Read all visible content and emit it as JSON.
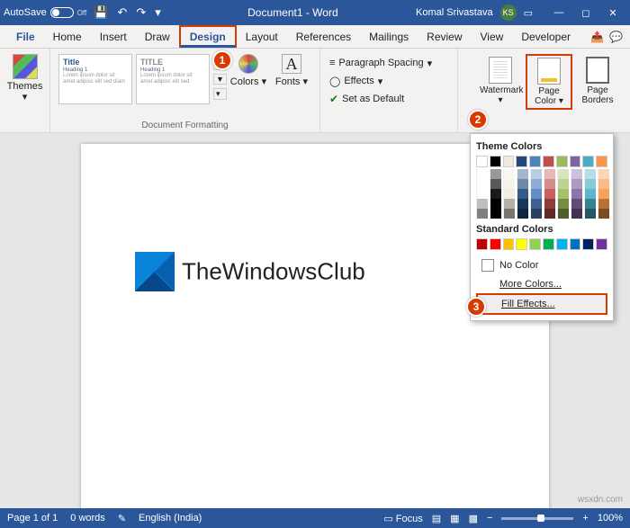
{
  "titlebar": {
    "autosave_label": "AutoSave",
    "autosave_state": "Off",
    "doc_title": "Document1 - Word",
    "user_name": "Komal Srivastava",
    "user_initials": "KS"
  },
  "tabs": {
    "file": "File",
    "home": "Home",
    "insert": "Insert",
    "draw": "Draw",
    "design": "Design",
    "layout": "Layout",
    "references": "References",
    "mailings": "Mailings",
    "review": "Review",
    "view": "View",
    "developer": "Developer"
  },
  "ribbon": {
    "themes": "Themes",
    "colors": "Colors",
    "fonts": "Fonts",
    "paragraph_spacing": "Paragraph Spacing",
    "effects": "Effects",
    "set_default": "Set as Default",
    "doc_formatting": "Document Formatting",
    "watermark": "Watermark",
    "page_color": "Page Color",
    "page_borders": "Page Borders",
    "style_title": "Title",
    "style_title2": "TITLE",
    "style_heading": "Heading 1"
  },
  "dropdown": {
    "theme_colors": "Theme Colors",
    "standard_colors": "Standard Colors",
    "no_color": "No Color",
    "more_colors": "More Colors...",
    "fill_effects": "Fill Effects...",
    "theme_row1": [
      "#ffffff",
      "#000000",
      "#eeece1",
      "#1f497d",
      "#4f81bd",
      "#c0504d",
      "#9bbb59",
      "#8064a2",
      "#4bacc6",
      "#f79646"
    ],
    "standard_row": [
      "#c00000",
      "#ff0000",
      "#ffc000",
      "#ffff00",
      "#92d050",
      "#00b050",
      "#00b0f0",
      "#0070c0",
      "#002060",
      "#7030a0"
    ]
  },
  "document": {
    "brand_text": "TheWindowsClub"
  },
  "status": {
    "page": "Page 1 of 1",
    "words": "0 words",
    "language": "English (India)",
    "focus": "Focus",
    "zoom": "100%"
  },
  "callouts": {
    "c1": "1",
    "c2": "2",
    "c3": "3"
  },
  "watermark": "wsxdn.com"
}
